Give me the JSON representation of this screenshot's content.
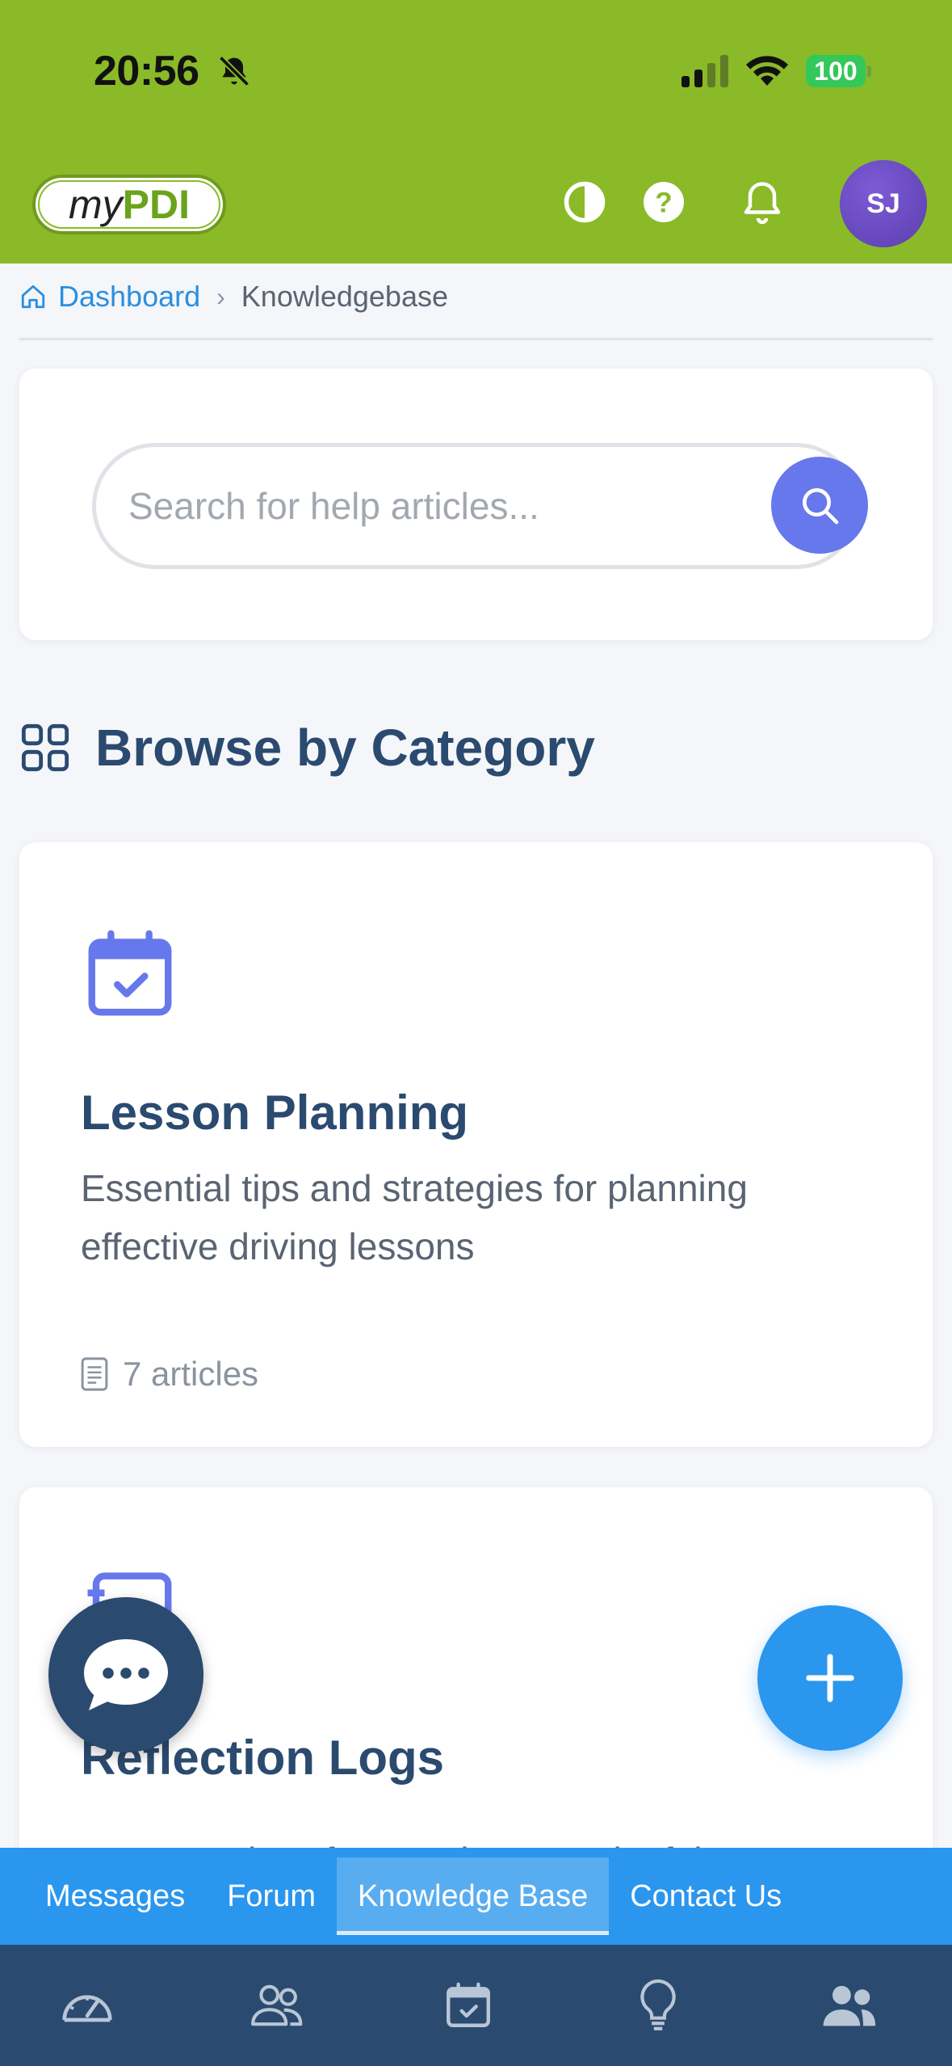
{
  "status_bar": {
    "time": "20:56",
    "battery": "100"
  },
  "header": {
    "logo_my": "my",
    "logo_pdi": "PDI",
    "avatar_initials": "SJ"
  },
  "breadcrumb": {
    "home": "Dashboard",
    "separator": "›",
    "current": "Knowledgebase"
  },
  "search": {
    "placeholder": "Search for help articles..."
  },
  "section": {
    "title": "Browse by Category"
  },
  "categories": [
    {
      "title": "Lesson Planning",
      "description": "Essential tips and strategies for planning effective driving lessons",
      "count": "7 articles",
      "icon": "calendar-check-icon"
    },
    {
      "title": "Reflection Logs",
      "description": "Best practices for creating meaningful",
      "icon": "reflection-icon"
    }
  ],
  "subnav": {
    "items": [
      "Messages",
      "Forum",
      "Knowledge Base",
      "Contact Us"
    ],
    "active": "Knowledge Base"
  },
  "tabbar": {
    "icons": [
      "speedometer-icon",
      "people-outline-icon",
      "calendar-check-icon",
      "lightbulb-icon",
      "people-solid-icon"
    ]
  },
  "colors": {
    "header_green": "#8aba28",
    "primary_blue": "#2a96ee",
    "navy": "#2b4a6f",
    "accent_indigo": "#6778ec"
  }
}
